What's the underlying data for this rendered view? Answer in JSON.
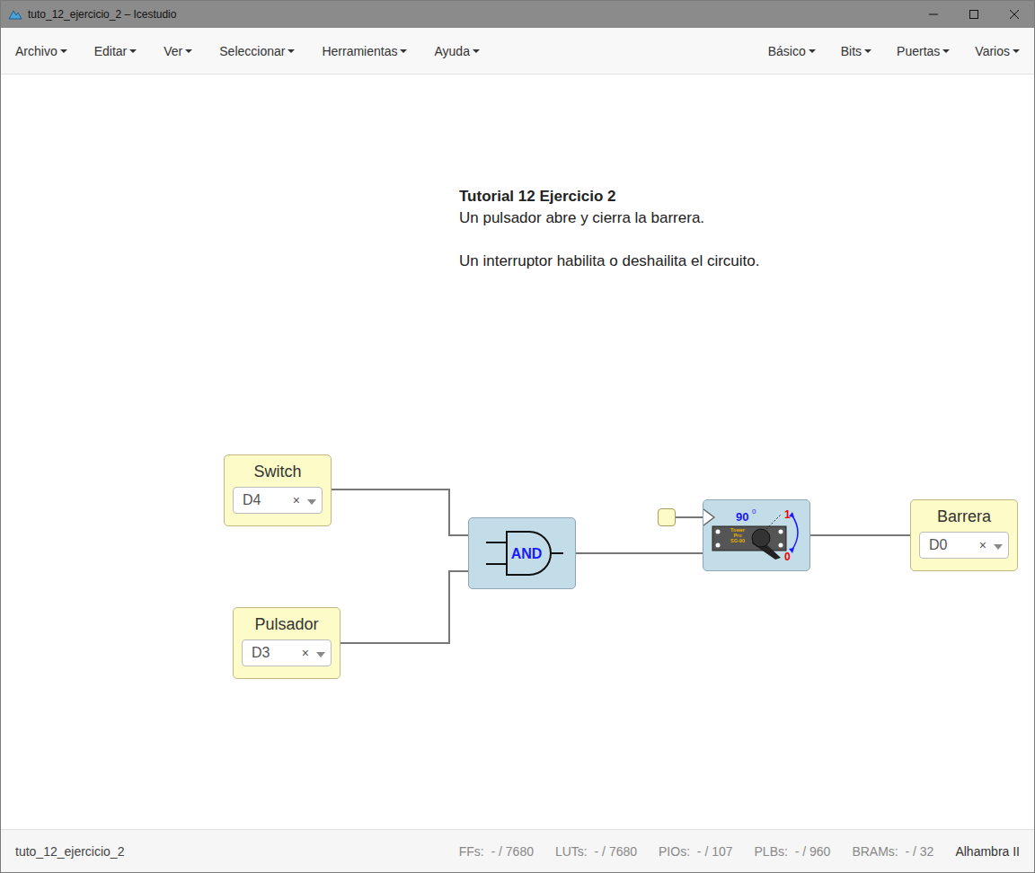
{
  "window": {
    "title": "tuto_12_ejercicio_2 – Icestudio"
  },
  "menu": {
    "left": [
      "Archivo",
      "Editar",
      "Ver",
      "Seleccionar",
      "Herramientas",
      "Ayuda"
    ],
    "right": [
      "Básico",
      "Bits",
      "Puertas",
      "Varios"
    ]
  },
  "comment": {
    "title": "Tutorial 12 Ejercicio 2",
    "lines": [
      "Un pulsador abre y cierra la barrera.",
      "",
      "Un interruptor habilita o deshailita el circuito."
    ]
  },
  "io_blocks": [
    {
      "label": "Switch",
      "pin": "D4",
      "clear": "×"
    },
    {
      "label": "Pulsador",
      "pin": "D3",
      "clear": "×"
    },
    {
      "label": "Barrera",
      "pin": "D0",
      "clear": "×"
    }
  ],
  "gate": {
    "label": "AND"
  },
  "servo": {
    "angle": "90",
    "degree": "0",
    "high": "1",
    "low": "0",
    "brand": [
      "Tower",
      "Pro",
      "SG-90"
    ]
  },
  "status_bar": {
    "file": "tuto_12_ejercicio_2",
    "counters": [
      {
        "label": "FFs:",
        "value": "- / 7680"
      },
      {
        "label": "LUTs:",
        "value": "- / 7680"
      },
      {
        "label": "PIOs:",
        "value": "- / 107"
      },
      {
        "label": "PLBs:",
        "value": "- / 960"
      },
      {
        "label": "BRAMs:",
        "value": "- / 32"
      }
    ],
    "board": "Alhambra II"
  }
}
